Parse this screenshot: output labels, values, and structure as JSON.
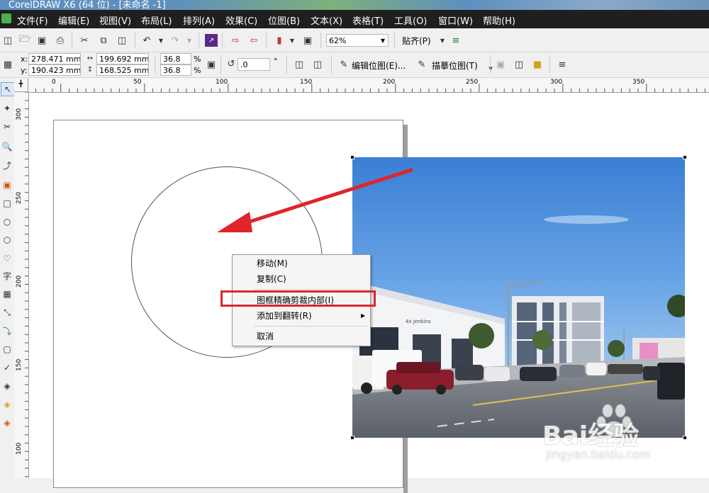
{
  "window": {
    "title": "CorelDRAW X6 (64 位) - [未命名 -1]"
  },
  "menubar": {
    "items": [
      "文件(F)",
      "编辑(E)",
      "视图(V)",
      "布局(L)",
      "排列(A)",
      "效果(C)",
      "位图(B)",
      "文本(X)",
      "表格(T)",
      "工具(O)",
      "窗口(W)",
      "帮助(H)"
    ]
  },
  "standard_toolbar": {
    "icons": [
      "new-icon",
      "open-icon",
      "save-icon",
      "print-icon",
      "cut-icon",
      "copy-icon",
      "paste-icon",
      "undo-icon",
      "redo-icon",
      "search-content-icon",
      "import-icon",
      "export-icon",
      "publish-pdf-icon",
      "app-launcher-icon"
    ],
    "zoom_value": "62%",
    "snap_label": "贴齐(P)"
  },
  "property_bar": {
    "x_label": "x:",
    "x_value": "278.471 mm",
    "y_label": "y:",
    "y_value": "190.423 mm",
    "width_value": "199.692 mm",
    "height_value": "168.525 mm",
    "scale_x": "36.8",
    "scale_y": "36.8",
    "percent": "%",
    "rotation_value": ".0",
    "degree": "°",
    "edit_bitmap_label": "编辑位图(E)...",
    "trace_bitmap_label": "描摹位图(T)"
  },
  "ruler": {
    "h_ticks": [
      "0",
      "50",
      "100",
      "150",
      "200",
      "250",
      "300",
      "350"
    ],
    "v_ticks": [
      "300",
      "250",
      "200",
      "150",
      "100"
    ]
  },
  "context_menu": {
    "items": [
      {
        "label": "移动(M)"
      },
      {
        "label": "复制(C)"
      },
      {
        "label": "图框精确剪裁内部(I)"
      },
      {
        "label": "添加到翻转(R)"
      },
      {
        "label": "取消"
      }
    ],
    "highlighted_index": 2,
    "highlight_color": "#e0242b"
  },
  "photo": {
    "storefront_sign": "4x Jenkins"
  },
  "watermark": {
    "brand": "Bai经验",
    "url": "jingyan.baidu.com"
  },
  "colors": {
    "menubar_bg": "#1f1f1f",
    "arrow": "#e0242b",
    "sky_top": "#3a7fd4",
    "sky_bottom": "#8fbcea"
  }
}
